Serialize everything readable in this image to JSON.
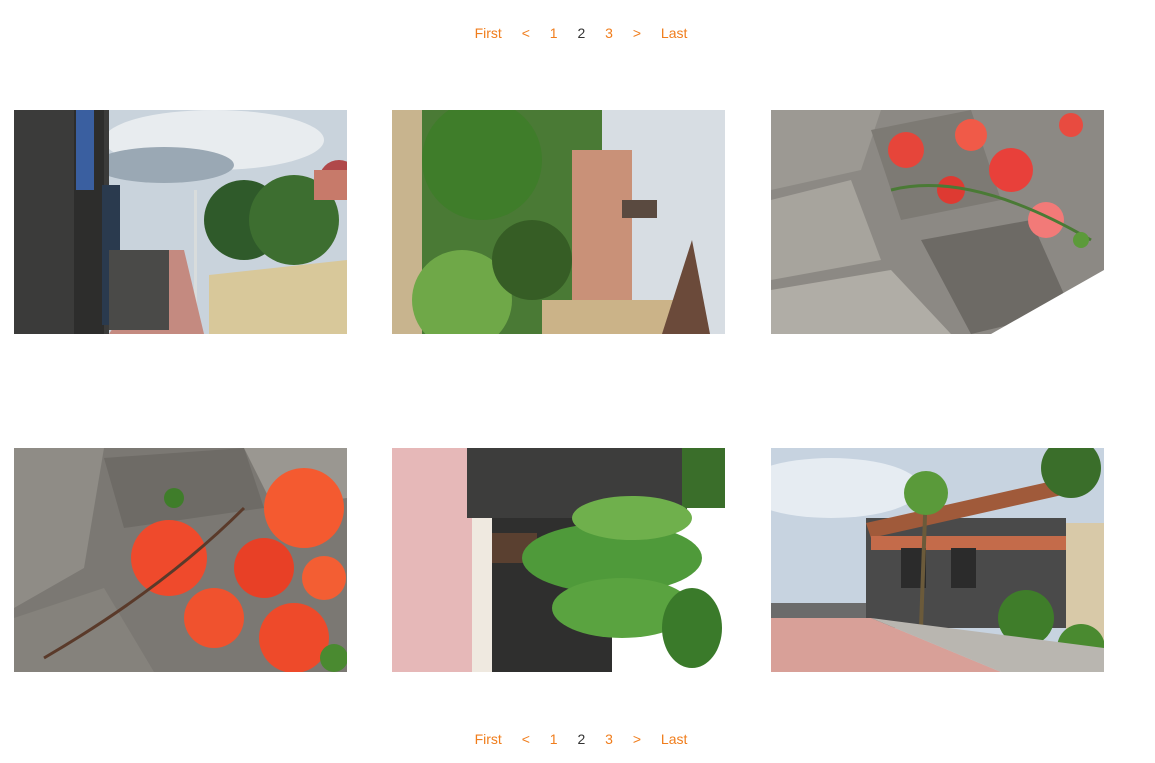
{
  "pagination": {
    "first_label": "First",
    "prev_label": "<",
    "pages": [
      "1",
      "2",
      "3"
    ],
    "current_page": "2",
    "next_label": ">",
    "last_label": "Last",
    "link_color": "#f07d1c",
    "current_color": "#333333"
  },
  "gallery": {
    "thumbnails": [
      {
        "subject": "promenade with spa banner and lamp post"
      },
      {
        "subject": "rotated view of tropical garden and tower building"
      },
      {
        "subject": "red bougainvillea on dark stone wall"
      },
      {
        "subject": "close-up of orange bougainvillea on rocks"
      },
      {
        "subject": "rotated palm tree against stone wall"
      },
      {
        "subject": "stone building with balcony and palm trees"
      }
    ]
  }
}
